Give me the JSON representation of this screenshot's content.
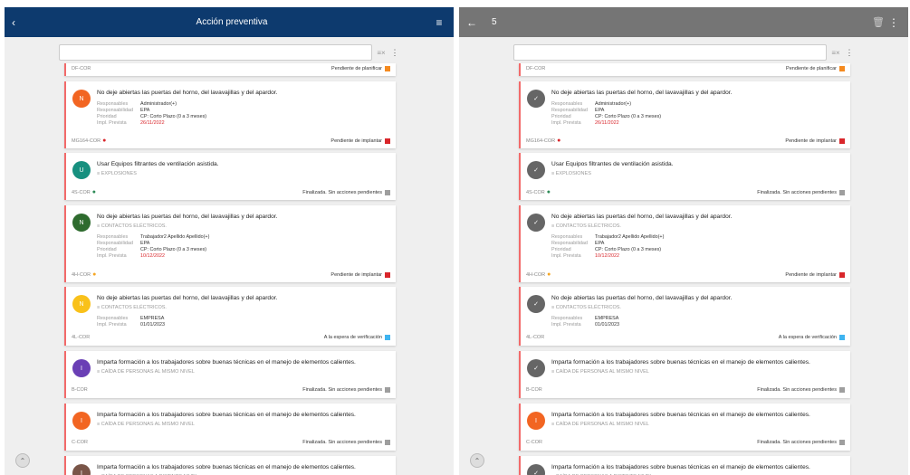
{
  "left": {
    "title": "Acción preventiva",
    "back_icon": "‹",
    "menu_icon": "≡"
  },
  "right": {
    "count": "5",
    "back_icon": "←",
    "trash_icon": "🗑",
    "menu_icon": "⋮"
  },
  "search": {
    "placeholder": ""
  },
  "colors": {
    "orange": "#f26522",
    "green": "#17907f",
    "darkgreen": "#2e6b2e",
    "yellow": "#f9c11a",
    "purple": "#6a3fb5",
    "brown": "#795548",
    "red": "#d9262b",
    "blue": "#3fb4f0",
    "gray": "#9e9e9e",
    "pending": "#f58a1f"
  },
  "labels": {
    "responsables": "Responsables",
    "responsabilidad": "Responsabilidad",
    "prioridad": "Prioridad",
    "impl": "Impl. Prevista"
  },
  "cards": [
    {
      "code": "DF-COR",
      "status": "Pendiente de planificar"
    },
    {
      "avatar": "N",
      "title": "No deje abiertas las puertas del horno, del lavavajillas y del apardor.",
      "responsables": "Administrador(+)",
      "responsabilidad": "EPA",
      "prioridad": "CP: Corto Plazo (0 a 3 meses)",
      "impl": "26/11/2022",
      "code": "MG164-COR",
      "status": "Pendiente de implantar"
    },
    {
      "avatar": "U",
      "title": "Usar Equipos filtrantes de ventilación asistida.",
      "subtitle": "EXPLOSIONES",
      "code": "4S-COR",
      "status": "Finalizada. Sin acciones pendientes"
    },
    {
      "avatar": "N",
      "title": "No deje abiertas las puertas del horno, del lavavajillas y del apardor.",
      "subtitle": "CONTACTOS ELÉCTRICOS.",
      "responsables": "Trabajador2 Apellido Apellido(+)",
      "responsabilidad": "EPA",
      "prioridad": "CP: Corto Plazo (0 a 3 meses)",
      "impl": "10/12/2022",
      "code": "4H-COR",
      "status": "Pendiente de implantar"
    },
    {
      "avatar": "N",
      "title": "No deje abiertas las puertas del horno, del lavavajillas y del apardor.",
      "subtitle": "CONTACTOS ELÉCTRICOS.",
      "responsables": "EMPRESA",
      "impl": "01/01/2023",
      "code": "4L-COR",
      "status": "A la espera de verificación"
    },
    {
      "avatar": "I",
      "title": "Imparta formación a los trabajadores sobre buenas técnicas en el manejo de elementos calientes.",
      "subtitle": "CAÍDA DE PERSONAS AL MISMO NIVEL",
      "code": "B-COR",
      "status": "Finalizada. Sin acciones pendientes"
    },
    {
      "avatar": "I",
      "title": "Imparta formación a los trabajadores sobre buenas técnicas en el manejo de elementos calientes.",
      "subtitle": "CAÍDA DE PERSONAS AL MISMO NIVEL",
      "code": "C-COR",
      "status": "Finalizada. Sin acciones pendientes"
    },
    {
      "avatar": "I",
      "title": "Imparta formación a los trabajadores sobre buenas técnicas en el manejo de elementos calientes.",
      "subtitle": "CAÍDA DE PERSONAS A DISTINTO NIVEL"
    }
  ],
  "fab_icon": "⌃"
}
